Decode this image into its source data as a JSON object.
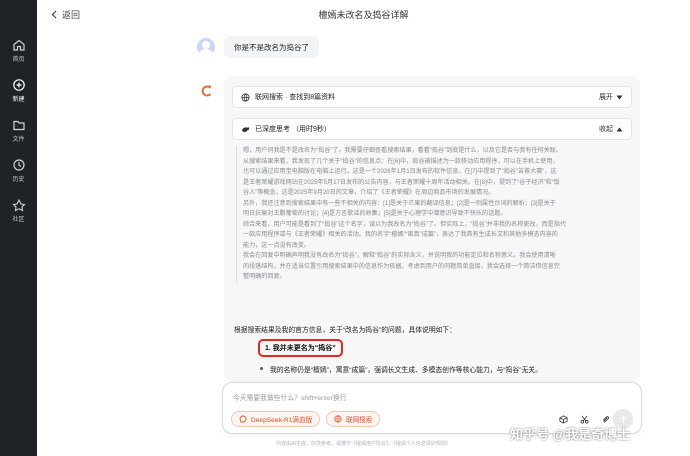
{
  "sidebar": {
    "items": [
      {
        "label": "首页",
        "icon": "home-icon"
      },
      {
        "label": "新建",
        "icon": "new-chat-icon"
      },
      {
        "label": "文件",
        "icon": "folder-icon"
      },
      {
        "label": "历史",
        "icon": "history-icon"
      },
      {
        "label": "社区",
        "icon": "community-icon"
      }
    ]
  },
  "header": {
    "back_label": "返回",
    "title": "檀嫣未改名及捣谷详解"
  },
  "user_message": "你是不是改名为捣谷了",
  "assistant": {
    "search_label": "联网搜索 · 查找到8篇资料",
    "search_toggle": "展开",
    "think_label": "已深度思考 （用时9秒）",
    "think_toggle": "收起",
    "thinking_lines": [
      "嗯，用户问我是不是改名为“捣谷”了。我需要仔细查看搜索结果，看看“捣谷”到底是什么，以及它是否与我有任何关联。",
      "从搜索结果来看，我发现了几个关于“捣谷”的信息点：在[6]中，捣谷被描述为一款移动应用程序，可以在手机上使用，",
      "也可以通过应用宝电脑版在电脑上运行。这是一个2026年1月1日发布的软件信息。在[7]中提到了“捣谷”苦茶大赛”，这",
      "是王者荣耀游戏网站在2025年5月17日发布的公告内容，与王者荣耀十周年活动相关。在[8]中，提到了“谷子经济”和“饭",
      "谷人”等概念，这是2025年9月20日的文章，介绍了《王者荣耀》在周边商品市场的发展情况。",
      "另外，我还注意到搜索结果中有一些不相关的内容：[1]是关于芒果的翻译信息；[2]是一则属性台词的解析；[3]是关于",
      "明日抗衡对王鹏葡萄的讨论；[4]是方言歌谣的收集；[5]是关于心理学中潜意识导致不快乐的话题。",
      "综合来看，用户可能是看到了“捣谷”这个名字，误以为我改名为“捣谷”了。但实际上，“捣谷”并非我的名称更改，而是指代",
      "一款应用程序或与《王者荣耀》相关的活动。我的名字“檀嫣”“离蒿”成篇”，表达了我具有生成长文和其他多模态内容的",
      "能力，这一点没有改变。",
      "我会在回复中明确声明我没有改名为“捣谷”，解释“捣谷”的实际含义，并说明我的功能定位和名称意义。我会使用清晰",
      "的段落结构，并在适当位置引用搜索结果中的信息作为依据。考虑到用户的问题简单直接，我会选择一个简洁但信息完",
      "整明确的回复。"
    ],
    "answer_intro": "根据搜索结果及我的官方信息，关于“改名为捣谷”的问题，具体说明如下：",
    "answer_heading": "1. 我并未更名为“捣谷”",
    "answer_bullet": "我的名称仍是“檀嫣”，寓意“成篇”，强调长文生成、多模态创作等核心能力，与“捣谷”无关。"
  },
  "input": {
    "placeholder": "今天需要我做些什么？shift+enter换行",
    "chip_model": "DeepSeek-R1满血版",
    "chip_search": "联网搜索"
  },
  "footer": "内容由AI生成，仅供参考。请遵守《檀嫣用户协议》、《檀嫣个人信息保护规则》",
  "watermark": "知乎号 @我是奇博士",
  "colors": {
    "accent": "#d4552f",
    "highlight_border": "#e02a1f",
    "sidebar_bg": "#1f2227"
  }
}
